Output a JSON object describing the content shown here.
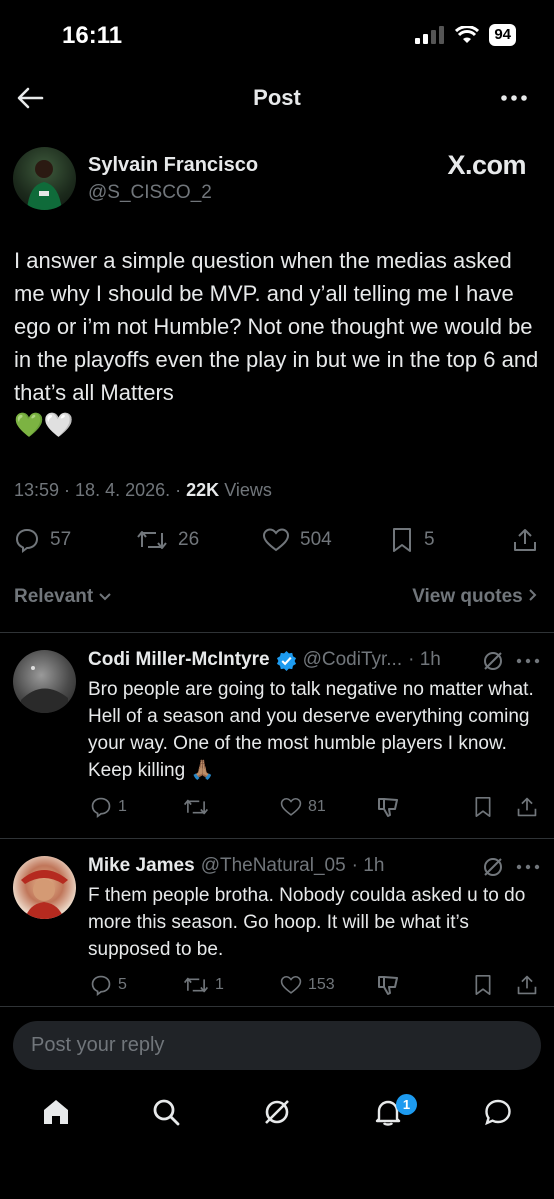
{
  "status_bar": {
    "time": "16:11",
    "battery": "94"
  },
  "header": {
    "title": "Post"
  },
  "post": {
    "author_name": "Sylvain Francisco",
    "author_handle": "@S_CISCO_2",
    "source_logo": "X.com",
    "text": "I answer a simple question when the medias asked me why I should be MVP. and y’all telling me I have ego or i’m not Humble? Not one thought we would be in the playoffs even the play in but we in the top 6 and that’s all Matters",
    "emojis": "💚🤍",
    "time": "13:59",
    "date": "18. 4. 2026.",
    "views_count": "22K",
    "views_label": "Views",
    "replies": "57",
    "reposts": "26",
    "likes": "504",
    "bookmarks": "5"
  },
  "filters": {
    "sort_label": "Relevant",
    "view_quotes_label": "View quotes"
  },
  "replies": [
    {
      "name": "Codi Miller-McIntyre",
      "handle": "@CodiTyr...",
      "time": "· 1h",
      "text": "Bro people are going to talk negative no matter what. Hell of a season and you deserve everything coming your way. One of the most humble players I know. Keep killing",
      "emoji": "🙏🏽",
      "reply_count": "1",
      "repost_count": "",
      "like_count": "81"
    },
    {
      "name": "Mike James",
      "handle": "@TheNatural_05",
      "time": "· 1h",
      "text": "F them people brotha. Nobody coulda asked u to do more this season. Go hoop. It will be what it’s supposed to be.",
      "emoji": "",
      "reply_count": "5",
      "repost_count": "1",
      "like_count": "153"
    }
  ],
  "composer": {
    "placeholder": "Post your reply"
  },
  "bottom_nav": {
    "notification_badge": "1"
  },
  "icons": [
    "back-arrow-icon",
    "more-icon",
    "reply-icon",
    "repost-icon",
    "like-icon",
    "bookmark-icon",
    "share-icon",
    "verified-icon",
    "grok-icon",
    "views-icon",
    "home-icon",
    "search-icon",
    "notifications-icon",
    "messages-icon"
  ]
}
